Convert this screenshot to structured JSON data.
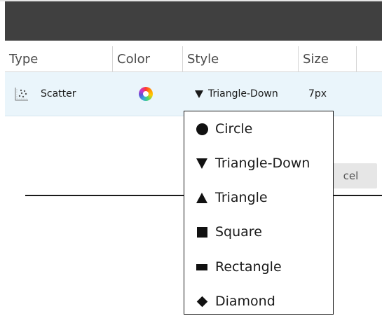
{
  "table": {
    "headers": {
      "type": "Type",
      "color": "Color",
      "style": "Style",
      "size": "Size"
    },
    "row": {
      "type_icon": "scatter-chart-icon",
      "type": "Scatter",
      "color_icon": "color-wheel-icon",
      "style_icon": "triangle-down-icon",
      "style": "Triangle-Down",
      "size": "7px"
    }
  },
  "cancel_button_label_partial": "cel",
  "style_dropdown": {
    "items": [
      {
        "icon": "circle-icon",
        "label": "Circle"
      },
      {
        "icon": "triangle-down-icon",
        "label": "Triangle-Down"
      },
      {
        "icon": "triangle-icon",
        "label": "Triangle"
      },
      {
        "icon": "square-icon",
        "label": "Square"
      },
      {
        "icon": "rectangle-icon",
        "label": "Rectangle"
      },
      {
        "icon": "diamond-icon",
        "label": "Diamond"
      }
    ]
  }
}
